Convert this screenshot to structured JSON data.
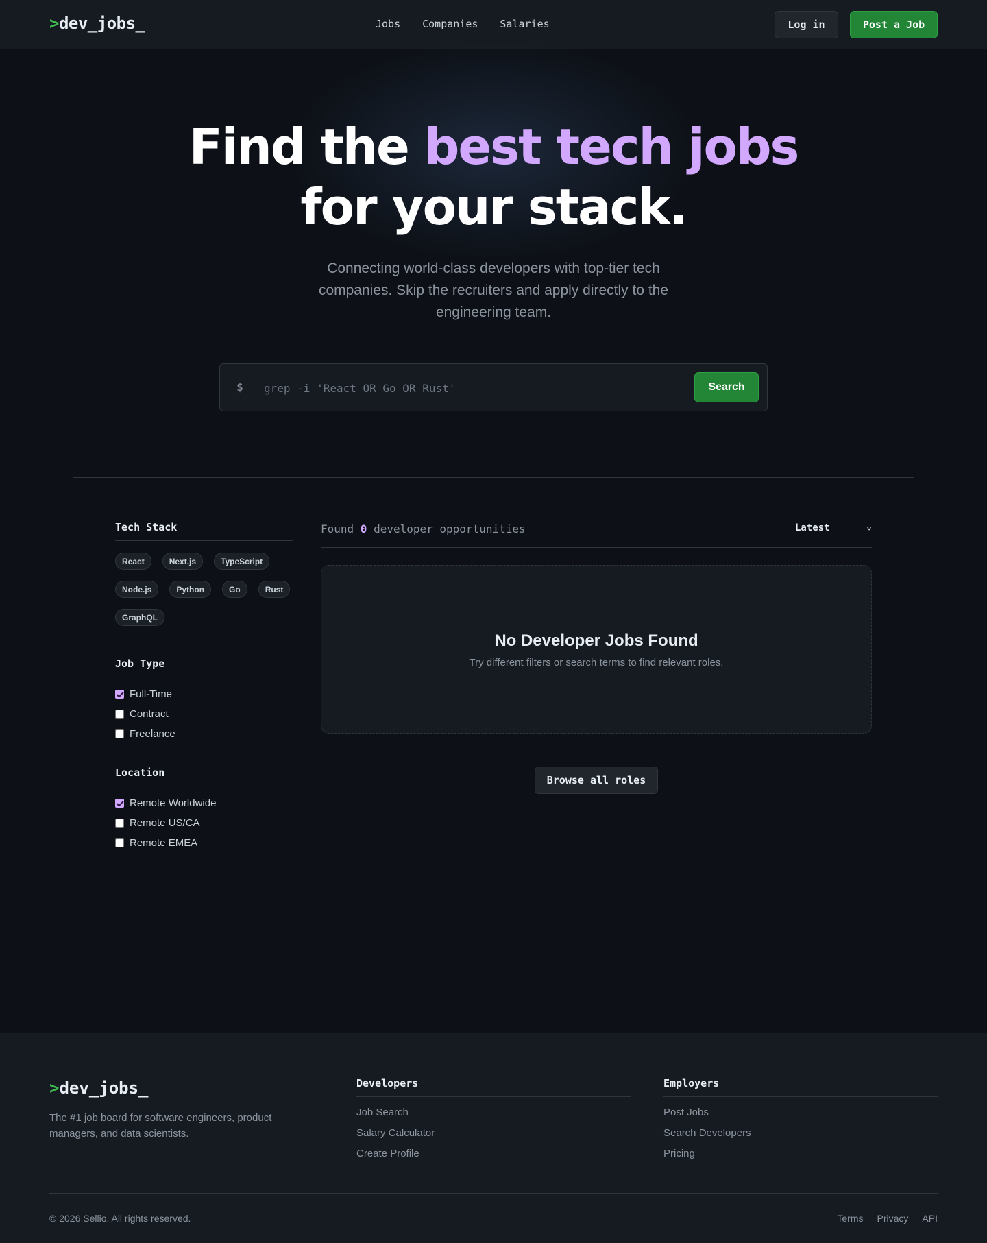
{
  "header": {
    "logo_prompt": ">",
    "logo_text": "dev_jobs_",
    "nav": [
      "Jobs",
      "Companies",
      "Salaries"
    ],
    "login_label": "Log in",
    "post_job_label": "Post a Job"
  },
  "hero": {
    "title_part1": "Find the ",
    "title_accent": "best tech jobs",
    "title_part2": "for your stack.",
    "subtitle": "Connecting world-class developers with top-tier tech companies. Skip the recruiters and apply directly to the engineering team.",
    "search_prompt": "$",
    "search_placeholder": "grep -i 'React OR Go OR Rust'",
    "search_button": "Search"
  },
  "filters": {
    "tech_stack_heading": "Tech Stack",
    "tech_tags": [
      "React",
      "Next.js",
      "TypeScript",
      "Node.js",
      "Python",
      "Go",
      "Rust",
      "GraphQL"
    ],
    "job_type_heading": "Job Type",
    "job_types": [
      {
        "label": "Full-Time",
        "checked": true
      },
      {
        "label": "Contract",
        "checked": false
      },
      {
        "label": "Freelance",
        "checked": false
      }
    ],
    "location_heading": "Location",
    "locations": [
      {
        "label": "Remote Worldwide",
        "checked": true
      },
      {
        "label": "Remote US/CA",
        "checked": false
      },
      {
        "label": "Remote EMEA",
        "checked": false
      }
    ]
  },
  "results": {
    "count_prefix": "Found ",
    "count": "0",
    "count_suffix": " developer opportunities",
    "sort_value": "Latest",
    "empty_title": "No Developer Jobs Found",
    "empty_subtitle": "Try different filters or search terms to find relevant roles.",
    "browse_button": "Browse all roles"
  },
  "footer": {
    "logo_prompt": ">",
    "logo_text": "dev_jobs_",
    "description": "The #1 job board for software engineers, product managers, and data scientists.",
    "developers_heading": "Developers",
    "developers_links": [
      "Job Search",
      "Salary Calculator",
      "Create Profile"
    ],
    "employers_heading": "Employers",
    "employers_links": [
      "Post Jobs",
      "Search Developers",
      "Pricing"
    ],
    "copyright": "© 2026 Sellio. All rights reserved.",
    "legal_links": [
      "Terms",
      "Privacy",
      "API"
    ]
  },
  "colors": {
    "background": "#0d1117",
    "accent_purple": "#d2a8ff",
    "accent_green": "#238636"
  }
}
